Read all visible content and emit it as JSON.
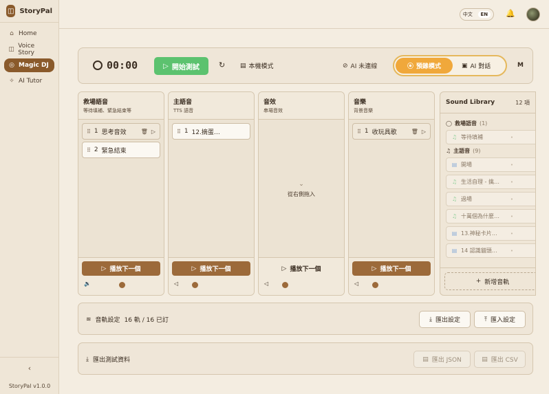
{
  "app": {
    "name": "StoryPal",
    "version": "StoryPal v1.0.0"
  },
  "sidebar": {
    "items": [
      {
        "label": "Home",
        "icon": "home-icon"
      },
      {
        "label": "Voice Story",
        "icon": "book-icon"
      },
      {
        "label": "Magic DJ",
        "icon": "disc-icon",
        "active": true
      },
      {
        "label": "AI Tutor",
        "icon": "sparkle-icon"
      }
    ],
    "collapse": "‹"
  },
  "topbar": {
    "lang_zh": "中文",
    "lang_en": "EN"
  },
  "control": {
    "timer": "00:00",
    "start_label": "開始測試",
    "local_label": "本機模式",
    "ai_status": "AI 未連線",
    "mode_rec": "預錄模式",
    "mode_ai": "AI 對話",
    "m_label": "M"
  },
  "columns": [
    {
      "title": "救場語音",
      "subtitle": "等待填補、緊急結束等",
      "tracks": [
        {
          "num": "1",
          "title": "思考音效",
          "style": "active"
        },
        {
          "num": "2",
          "title": "緊急結束",
          "style": "light"
        }
      ],
      "play_label": "播放下一個"
    },
    {
      "title": "主語音",
      "subtitle": "TTS 語音",
      "tracks": [
        {
          "num": "1",
          "title": "12.摘蛋…",
          "style": "light"
        }
      ],
      "play_label": "播放下一個"
    },
    {
      "title": "音效",
      "subtitle": "串場音效",
      "tracks": [],
      "empty_label": "從右側拖入",
      "play_label": "播放下一個"
    },
    {
      "title": "音樂",
      "subtitle": "背景音樂",
      "tracks": [
        {
          "num": "1",
          "title": "收玩具歌",
          "style": "active"
        }
      ],
      "play_label": "播放下一個"
    }
  ],
  "library": {
    "title": "Sound Library",
    "count": "12 項",
    "groups": [
      {
        "name": "救場語音",
        "count": "(1)",
        "items": [
          {
            "title": "等待填補",
            "kind": "mic"
          }
        ]
      },
      {
        "name": "主語音",
        "count": "(9)",
        "items": [
          {
            "title": "開場",
            "kind": "file"
          },
          {
            "title": "生活自理 - 擒…",
            "kind": "mic"
          },
          {
            "title": "過場",
            "kind": "mic"
          },
          {
            "title": "十萬個為什麼…",
            "kind": "mic"
          },
          {
            "title": "13.神秘卡片…",
            "kind": "file"
          },
          {
            "title": "14 認識貓頭…",
            "kind": "file"
          }
        ]
      }
    ],
    "add_label": "新增音軌"
  },
  "track_settings": {
    "label": "音軌設定",
    "count": "16 軌 / 16 已訂",
    "export_label": "匯出設定",
    "import_label": "匯入設定"
  },
  "export_data": {
    "label": "匯出測試資料",
    "json_label": "匯出 JSON",
    "csv_label": "匯出 CSV"
  },
  "colors": {
    "accent": "#9c6a3a",
    "start_green": "#5cc26f",
    "mode_orange": "#f0a83b"
  }
}
